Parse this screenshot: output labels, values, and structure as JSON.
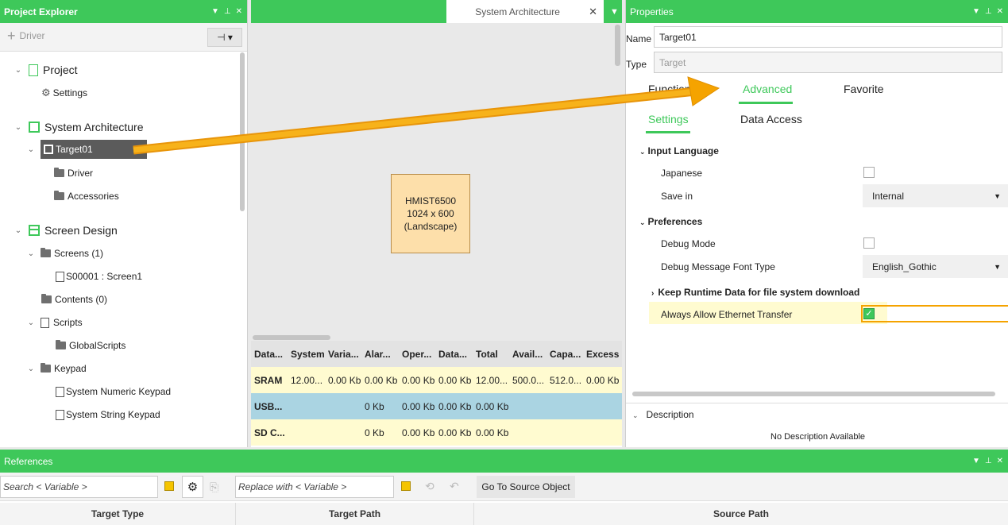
{
  "project_explorer": {
    "title": "Project Explorer",
    "toolbar": {
      "add_driver": "Driver"
    },
    "tree": {
      "project": "Project",
      "settings": "Settings",
      "system_architecture": "System Architecture",
      "target": "Target01",
      "driver": "Driver",
      "accessories": "Accessories",
      "screen_design": "Screen Design",
      "screens": "Screens (1)",
      "screen1": "S00001 : Screen1",
      "contents": "Contents (0)",
      "scripts": "Scripts",
      "global_scripts": "GlobalScripts",
      "keypad": "Keypad",
      "numeric_keypad": "System Numeric Keypad",
      "string_keypad": "System String Keypad"
    }
  },
  "document": {
    "tab_title": "System Architecture",
    "device": {
      "model": "HMIST6500",
      "resolution": "1024 x 600",
      "orientation": "(Landscape)"
    }
  },
  "memory_table": {
    "headers": [
      "Data...",
      "System",
      "Varia...",
      "Alar...",
      "Oper...",
      "Data...",
      "Total",
      "Avail...",
      "Capa...",
      "Excess"
    ],
    "rows": [
      [
        "SRAM",
        "12.00...",
        "0.00 Kb",
        "0.00 Kb",
        "0.00 Kb",
        "0.00 Kb",
        "12.00...",
        "500.0...",
        "512.0...",
        "0.00 Kb"
      ],
      [
        "USB...",
        "",
        "",
        "0 Kb",
        "0.00 Kb",
        "0.00 Kb",
        "0.00 Kb",
        "",
        "",
        ""
      ],
      [
        "SD C...",
        "",
        "",
        "0 Kb",
        "0.00 Kb",
        "0.00 Kb",
        "0.00 Kb",
        "",
        "",
        ""
      ]
    ]
  },
  "properties": {
    "title": "Properties",
    "name_label": "Name",
    "name_value": "Target01",
    "type_label": "Type",
    "type_value": "Target",
    "tabs": [
      "Function",
      "Advanced",
      "Favorite"
    ],
    "subtabs": [
      "Settings",
      "Data Access"
    ],
    "input_language": {
      "header": "Input Language",
      "japanese_label": "Japanese",
      "save_in_label": "Save in",
      "save_in_value": "Internal"
    },
    "preferences": {
      "header": "Preferences",
      "debug_mode_label": "Debug Mode",
      "debug_font_label": "Debug Message Font Type",
      "debug_font_value": "English_Gothic"
    },
    "keep_runtime": "Keep Runtime Data for file system download",
    "always_allow": "Always Allow Ethernet Transfer",
    "description_header": "Description",
    "description_text": "No Description Available"
  },
  "references": {
    "title": "References",
    "search_placeholder": "Search  < Variable >",
    "replace_placeholder": "Replace with < Variable >",
    "go_to_source": "Go To Source Object",
    "columns": [
      "Target Type",
      "Target Path",
      "Source Path"
    ]
  },
  "colors": {
    "accent": "#3ec85a",
    "arrow": "#f5a300",
    "selected_row": "#aad4e2",
    "highlight": "#fffbd0"
  }
}
